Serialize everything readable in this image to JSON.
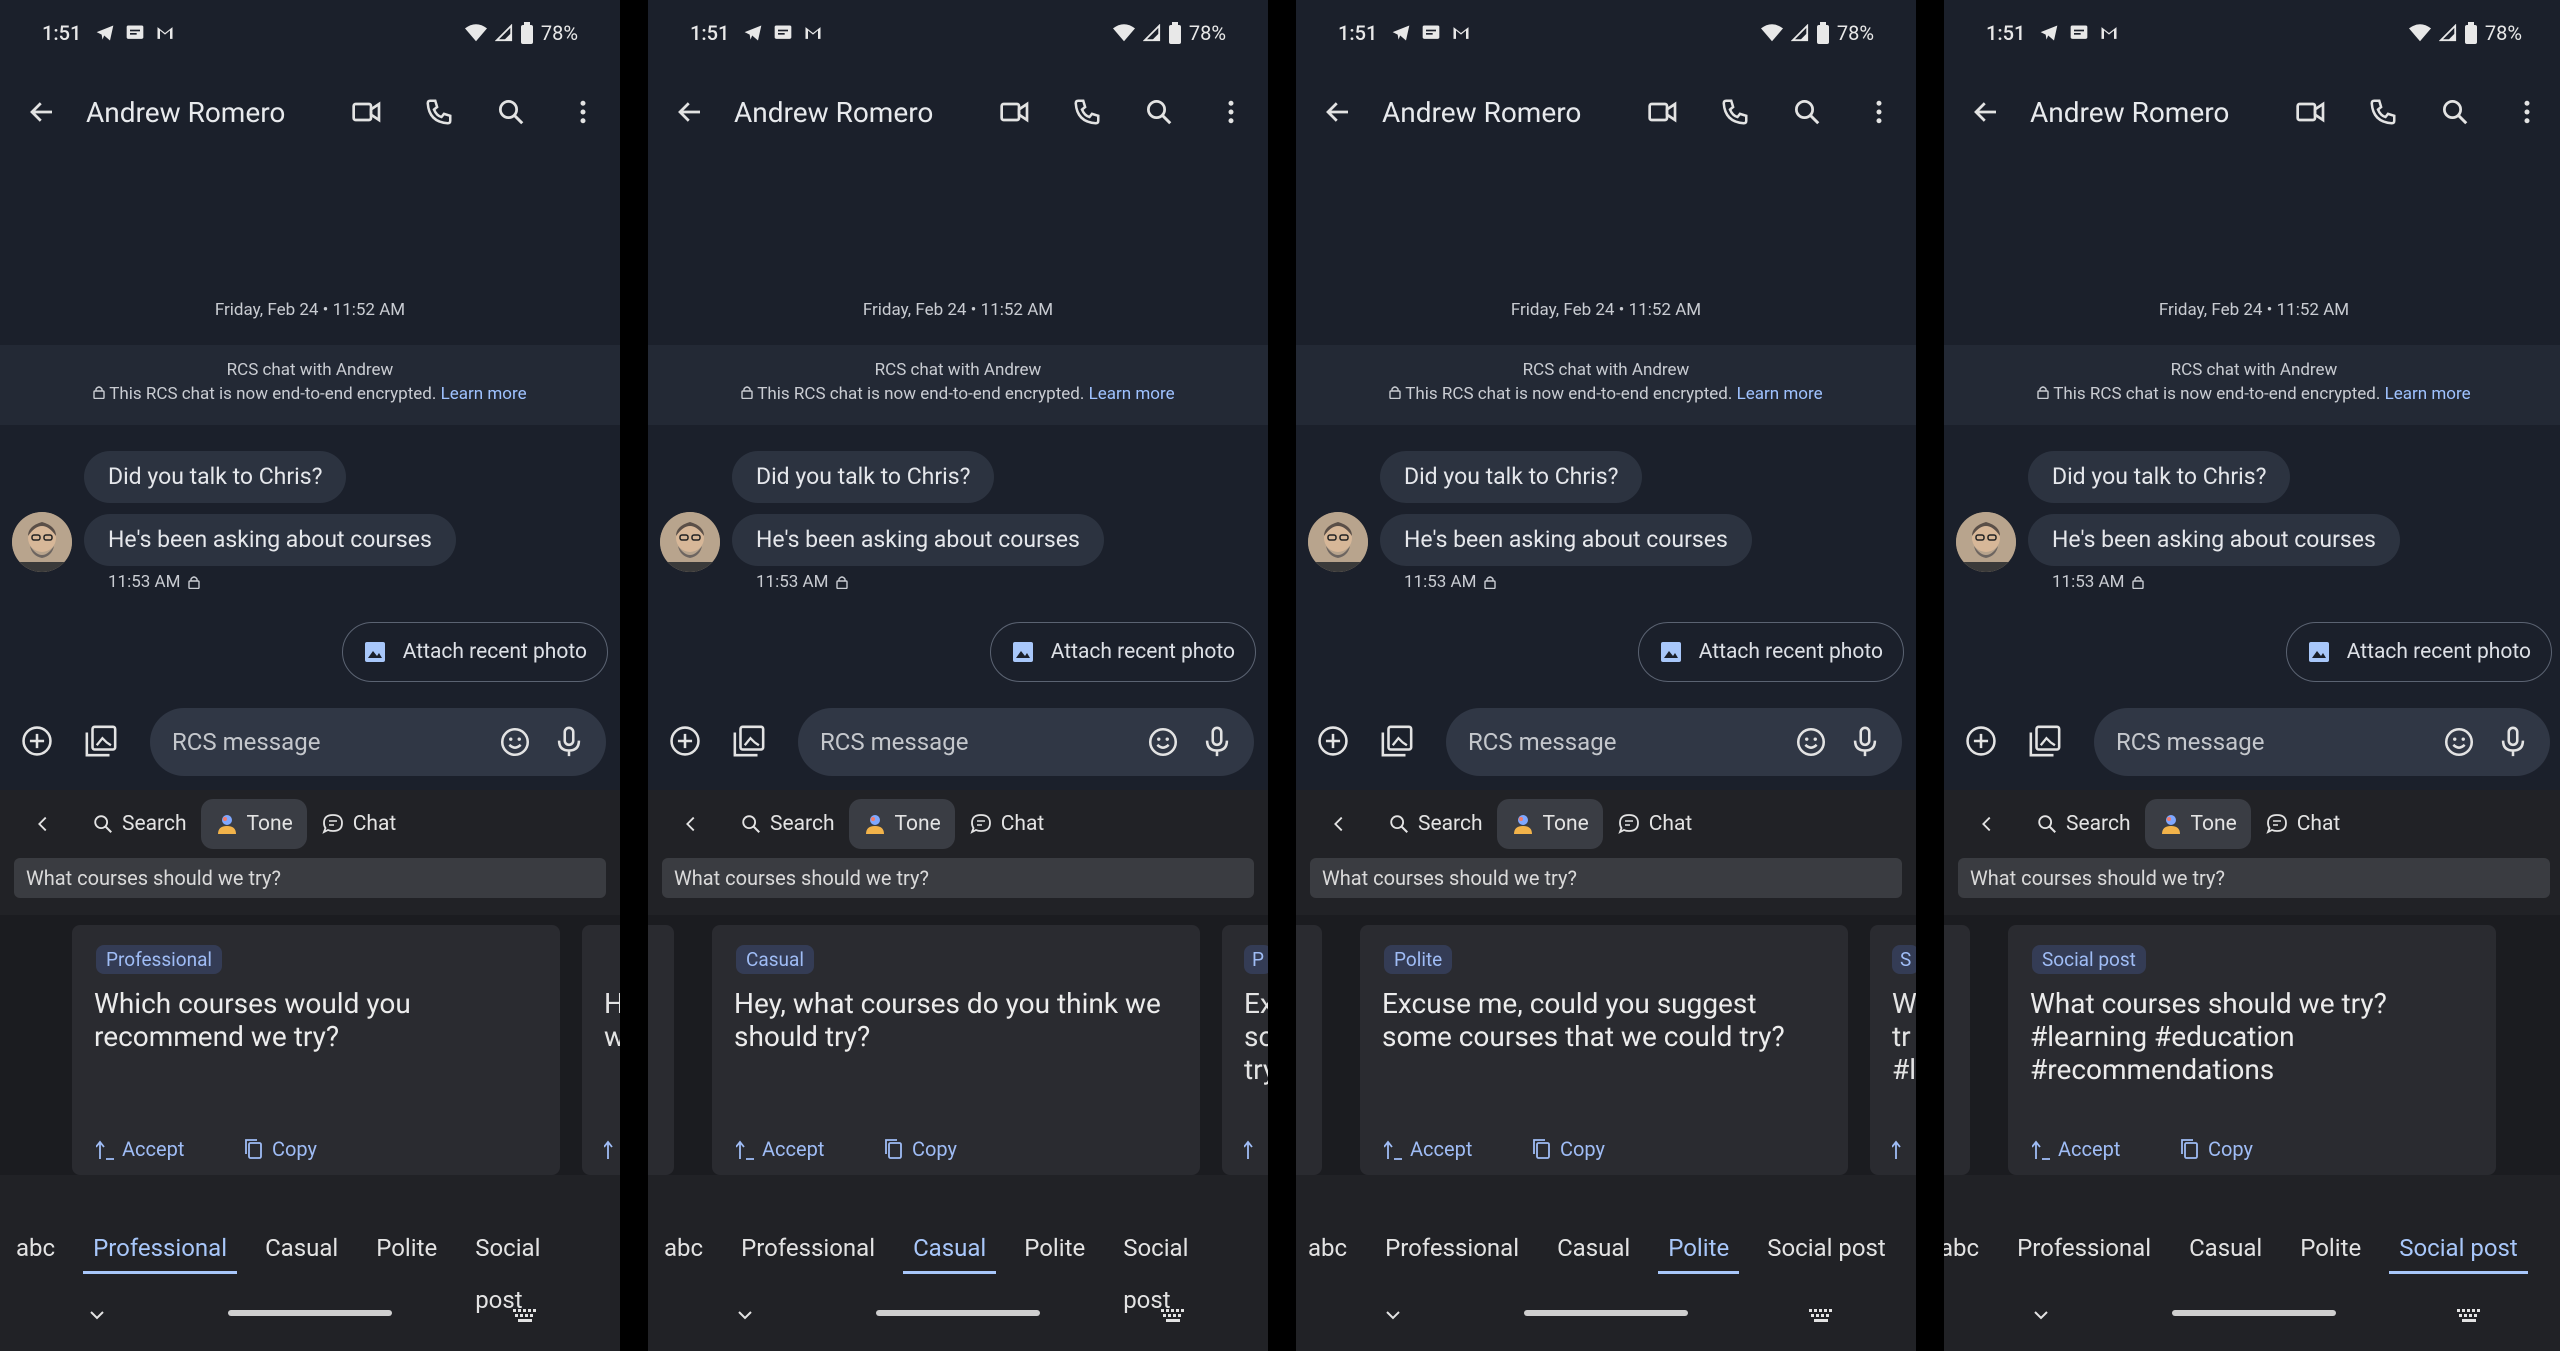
{
  "status": {
    "time": "1:51",
    "battery": "78%"
  },
  "contact": {
    "name": "Andrew Romero"
  },
  "date_header": "Friday, Feb 24 • 11:52 AM",
  "rcs": {
    "line1": "RCS chat with Andrew",
    "line2": "This RCS chat is now end-to-end encrypted.",
    "learn_more": "Learn more"
  },
  "messages": [
    "Did you talk to Chris?",
    "He's been asking about courses"
  ],
  "msg_time": "11:53 AM",
  "attach_label": "Attach recent photo",
  "composer_placeholder": "RCS message",
  "kb_tabs": {
    "search": "Search",
    "tone": "Tone",
    "chat": "Chat"
  },
  "query": "What courses should we try?",
  "actions": {
    "accept": "Accept",
    "copy": "Copy"
  },
  "bottom_tabs": [
    "abc",
    "Professional",
    "Casual",
    "Polite",
    "Social post"
  ],
  "panels": [
    {
      "badge": "Professional",
      "text": "Which courses would you recommend we try?",
      "active_tab": 1,
      "next_stub": {
        "badge": "",
        "text": "H\nw"
      },
      "prev_stub": null
    },
    {
      "badge": "Casual",
      "text": "Hey, what courses do you think we should try?",
      "active_tab": 2,
      "next_stub": {
        "badge": "P",
        "text": "Ex\nso\ntry"
      },
      "prev_stub": true
    },
    {
      "badge": "Polite",
      "text": "Excuse me, could you suggest some courses that we could try?",
      "active_tab": 3,
      "next_stub": {
        "badge": "S",
        "text": "W\ntr\n#l"
      },
      "prev_stub": true
    },
    {
      "badge": "Social post",
      "text": "What courses should we try? #learning #education #recommendations",
      "active_tab": 4,
      "next_stub": null,
      "prev_stub": true
    }
  ],
  "colors": {
    "accent": "#a8c7fa",
    "badge_bg": "#343c55",
    "bg": "#1b202b"
  }
}
